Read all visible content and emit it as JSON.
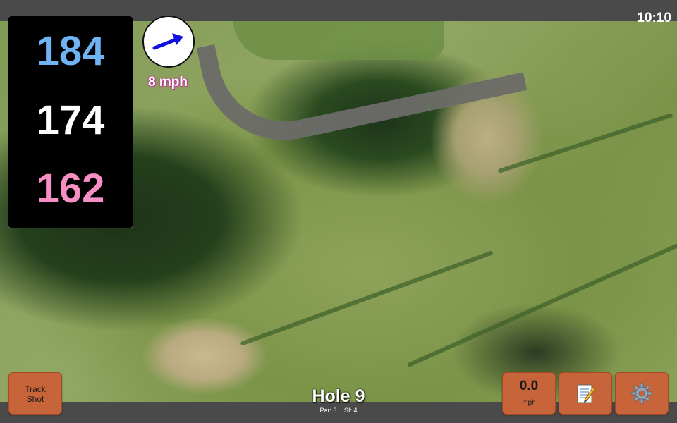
{
  "status_bar": {
    "time": "10:10"
  },
  "distances": {
    "back": "184",
    "middle": "174",
    "front": "162"
  },
  "wind": {
    "speed": "8 mph",
    "arrow_icon": "wind-arrow-icon"
  },
  "buttons": {
    "track_shot_line1": "Track",
    "track_shot_line2": "Shot",
    "speed_value": "0.0",
    "speed_unit": "mph",
    "notes_icon": "notepad-icon",
    "settings_icon": "gear-icon"
  },
  "hole": {
    "title": "Hole 9",
    "par": "Par: 3",
    "si": "SI: 4"
  },
  "colors": {
    "back_distance": "#6fb3f2",
    "middle_distance": "#ffffff",
    "front_distance": "#f58fc4",
    "button_orange": "#c8643a",
    "bar_gray": "#4a4a4a"
  }
}
